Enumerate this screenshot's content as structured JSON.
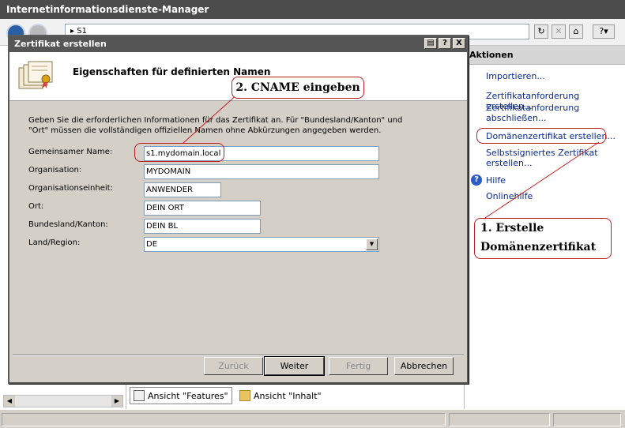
{
  "window": {
    "title": "Internetinformationsdienste-Manager",
    "address_path": "S1",
    "address_arrow": "▸"
  },
  "actions_pane": {
    "header": "Aktionen",
    "items": [
      "Importieren...",
      "Zertifikatanforderung erstellen...",
      "Zertifikatanforderung abschließen...",
      "Domänenzertifikat erstellen...",
      "Selbstsigniertes Zertifikat erstellen...",
      "Hilfe",
      "Onlinehilfe"
    ]
  },
  "view_tabs": {
    "features": "Ansicht \"Features\"",
    "content": "Ansicht \"Inhalt\""
  },
  "dialog": {
    "title": "Zertifikat erstellen",
    "heading": "Eigenschaften für definierten Namen",
    "description": "Geben Sie die erforderlichen Informationen für das Zertifikat an. Für \"Bundesland/Kanton\" und \"Ort\" müssen die vollständigen offiziellen Namen ohne Abkürzungen angegeben werden.",
    "fields": {
      "common_name": {
        "label": "Gemeinsamer Name:",
        "value": "s1.mydomain.local"
      },
      "organization": {
        "label": "Organisation:",
        "value": "MYDOMAIN"
      },
      "org_unit": {
        "label": "Organisationseinheit:",
        "value": "ANWENDER"
      },
      "city": {
        "label": "Ort:",
        "value": "DEIN ORT"
      },
      "state": {
        "label": "Bundesland/Kanton:",
        "value": "DEIN BL"
      },
      "country": {
        "label": "Land/Region:",
        "value": "DE"
      }
    },
    "buttons": {
      "back": "Zurück",
      "next": "Weiter",
      "finish": "Fertig",
      "cancel": "Abbrechen"
    },
    "title_buttons": {
      "help": "?",
      "close": "X"
    }
  },
  "annotations": {
    "step2": "2. CNAME eingeben",
    "step1_line1": "1. Erstelle",
    "step1_line2": "Domänenzertifikat"
  },
  "colors": {
    "annotation": "#c02020",
    "link": "#0a2a88",
    "titlebar": "#4c4c4c"
  }
}
